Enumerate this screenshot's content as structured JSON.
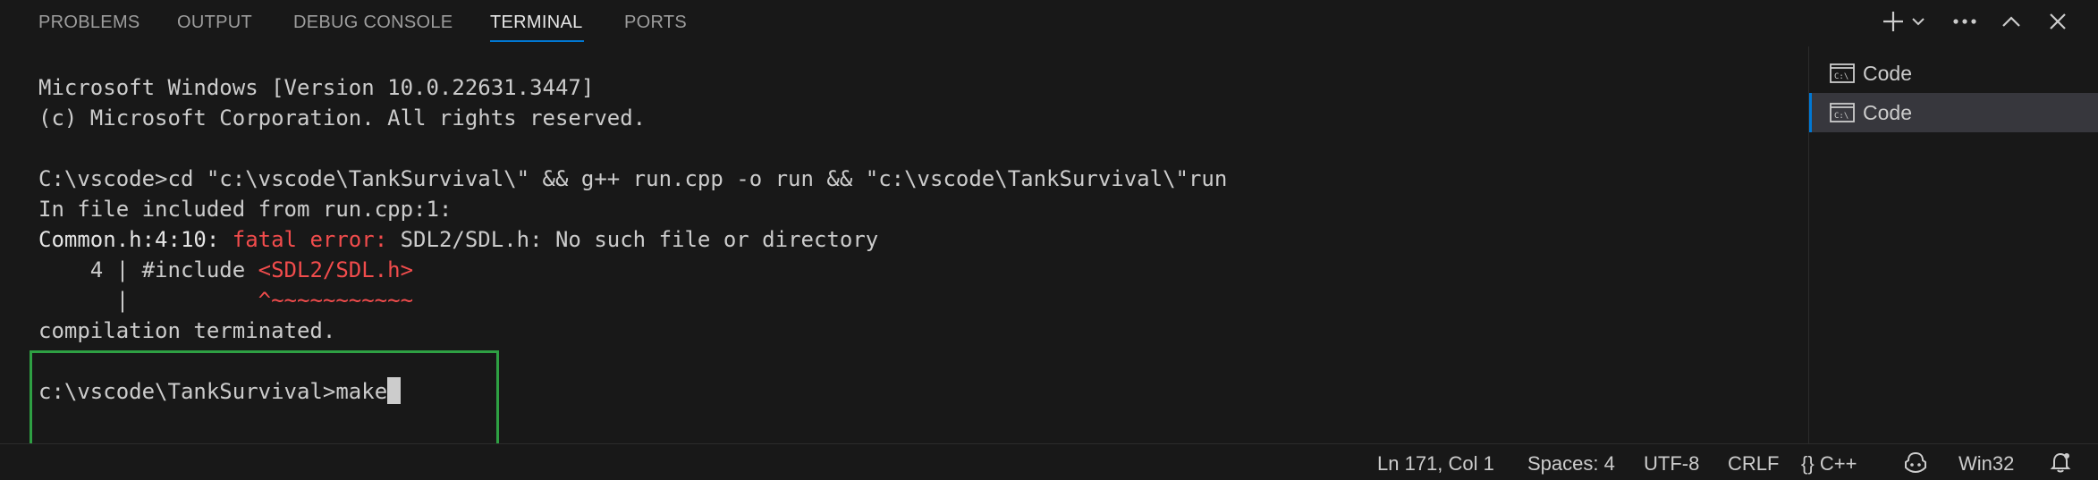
{
  "panel": {
    "tabs": [
      {
        "label": "PROBLEMS"
      },
      {
        "label": "OUTPUT"
      },
      {
        "label": "DEBUG CONSOLE"
      },
      {
        "label": "TERMINAL"
      },
      {
        "label": "PORTS"
      }
    ],
    "active_tab": "TERMINAL"
  },
  "toolbar": {
    "icons": [
      "plus-icon",
      "chevron-down-icon",
      "ellipsis-icon",
      "chevron-up-icon",
      "close-icon"
    ]
  },
  "terminal": {
    "lines": {
      "l1": "Microsoft Windows [Version 10.0.22631.3447]",
      "l2": "(c) Microsoft Corporation. All rights reserved.",
      "l4": "C:\\vscode>cd \"c:\\vscode\\TankSurvival\\\" && g++ run.cpp -o run && \"c:\\vscode\\TankSurvival\\\"run",
      "l5": "In file included from run.cpp:1:",
      "l6_loc": "Common.h:4:10: ",
      "l6_err": "fatal error: ",
      "l6_msg": "SDL2/SDL.h: No such file or directory",
      "l7_prefix": "    4 | #include ",
      "l7_hl": "<SDL2/SDL.h>",
      "l8_prefix": "      |          ",
      "l8_caret": "^~~~~~~~~~~~",
      "l9": "compilation terminated.",
      "prompt": "c:\\vscode\\TankSurvival>",
      "command": "make"
    }
  },
  "terminal_list": {
    "items": [
      {
        "label": "Code",
        "icon": "terminal-cmd-icon"
      },
      {
        "label": "Code",
        "icon": "terminal-cmd-icon"
      }
    ]
  },
  "statusbar": {
    "position": "Ln 171, Col 1",
    "spaces": "Spaces: 4",
    "encoding": "UTF-8",
    "eol": "CRLF",
    "language_icon": "{}",
    "language": "C++",
    "platform": "Win32"
  },
  "colors": {
    "background": "#181818",
    "accent": "#0078d4",
    "error": "#f14c4c",
    "highlight_box": "#2ea043"
  }
}
